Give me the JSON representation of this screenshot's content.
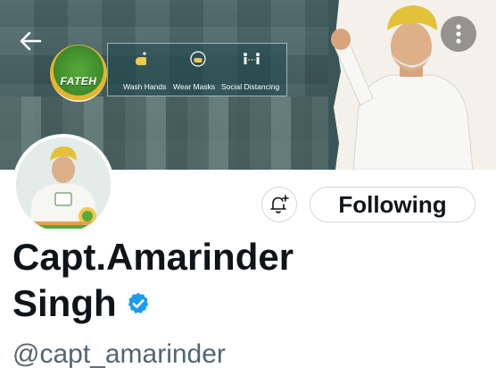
{
  "banner": {
    "logo_text": "FATEH",
    "campaign_items": [
      {
        "label": "Wash Hands",
        "icon": "hand-wash-icon"
      },
      {
        "label": "Wear Masks",
        "icon": "mask-icon"
      },
      {
        "label": "Social Distancing",
        "icon": "social-distancing-icon"
      }
    ]
  },
  "profile": {
    "display_name_line1": "Capt.Amarinder",
    "display_name_line2": "Singh",
    "handle": "@capt_amarinder",
    "verified": true
  },
  "actions": {
    "following_label": "Following",
    "notify_icon": "bell-plus-icon"
  },
  "nav": {
    "back_icon": "back-arrow-icon",
    "more_icon": "more-icon"
  },
  "colors": {
    "verified": "#1d9bf0",
    "text_primary": "#0f1419",
    "text_secondary": "#536471",
    "border": "#cfd9de"
  }
}
